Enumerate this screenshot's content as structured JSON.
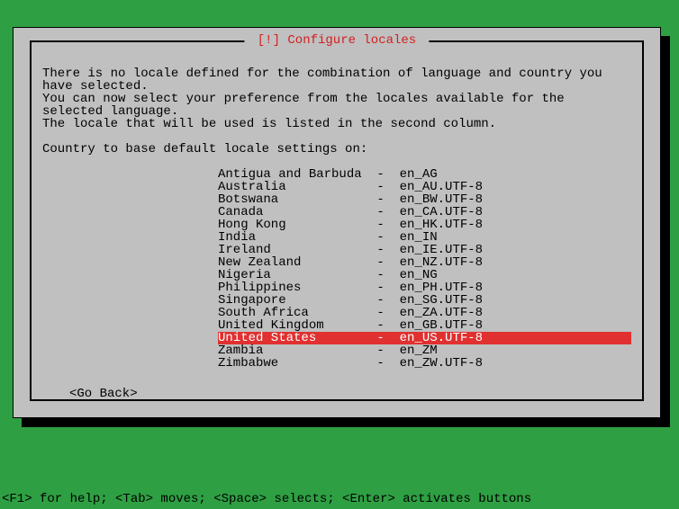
{
  "dialog": {
    "title": " [!] Configure locales ",
    "body": "There is no locale defined for the combination of language and country you have selected.\nYou can now select your preference from the locales available for the selected language.\nThe locale that will be used is listed in the second column.",
    "prompt": "Country to base default locale settings on:",
    "go_back": "<Go Back>",
    "selected_index": 13,
    "items": [
      {
        "country": "Antigua and Barbuda",
        "locale": "en_AG"
      },
      {
        "country": "Australia",
        "locale": "en_AU.UTF-8"
      },
      {
        "country": "Botswana",
        "locale": "en_BW.UTF-8"
      },
      {
        "country": "Canada",
        "locale": "en_CA.UTF-8"
      },
      {
        "country": "Hong Kong",
        "locale": "en_HK.UTF-8"
      },
      {
        "country": "India",
        "locale": "en_IN"
      },
      {
        "country": "Ireland",
        "locale": "en_IE.UTF-8"
      },
      {
        "country": "New Zealand",
        "locale": "en_NZ.UTF-8"
      },
      {
        "country": "Nigeria",
        "locale": "en_NG"
      },
      {
        "country": "Philippines",
        "locale": "en_PH.UTF-8"
      },
      {
        "country": "Singapore",
        "locale": "en_SG.UTF-8"
      },
      {
        "country": "South Africa",
        "locale": "en_ZA.UTF-8"
      },
      {
        "country": "United Kingdom",
        "locale": "en_GB.UTF-8"
      },
      {
        "country": "United States",
        "locale": "en_US.UTF-8"
      },
      {
        "country": "Zambia",
        "locale": "en_ZM"
      },
      {
        "country": "Zimbabwe",
        "locale": "en_ZW.UTF-8"
      }
    ]
  },
  "statusbar": "<F1> for help; <Tab> moves; <Space> selects; <Enter> activates buttons"
}
